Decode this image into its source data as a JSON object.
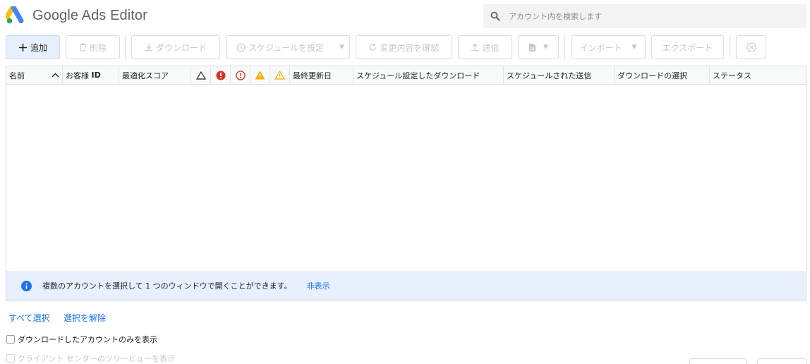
{
  "header": {
    "app_title": "Google Ads Editor",
    "search_placeholder": "アカウント内を検索します"
  },
  "toolbar": {
    "add_label": "追加",
    "delete_label": "削除",
    "download_label": "ダウンロード",
    "schedule_label": "スケジュールを設定",
    "review_label": "変更内容を確認",
    "send_label": "送信",
    "import_label": "インポート",
    "export_label": "エクスポート"
  },
  "grid": {
    "columns": {
      "name": "名前",
      "customer_id_prefix": "お客様",
      "customer_id_suffix": "ID",
      "opt_score": "最適化スコア",
      "last_updated": "最終更新日",
      "scheduled_download": "スケジュール設定したダウンロード",
      "scheduled_send": "スケジュールされた送信",
      "download_select": "ダウンロードの選択",
      "status": "ステータス"
    },
    "info_text": "複数のアカウントを選択して 1 つのウィンドウで開くことができます。",
    "info_hide": "非表示"
  },
  "footer": {
    "select_all": "すべて選択",
    "deselect": "選択を解除",
    "only_downloaded": "ダウンロードしたアカウントのみを表示",
    "tree_view": "クライアント センターのツリービューを表示"
  },
  "colors": {
    "accent": "#1a73e8",
    "error_red": "#d93025",
    "warning_yellow": "#f9ab00",
    "info_bar": "#e8f0fe"
  }
}
